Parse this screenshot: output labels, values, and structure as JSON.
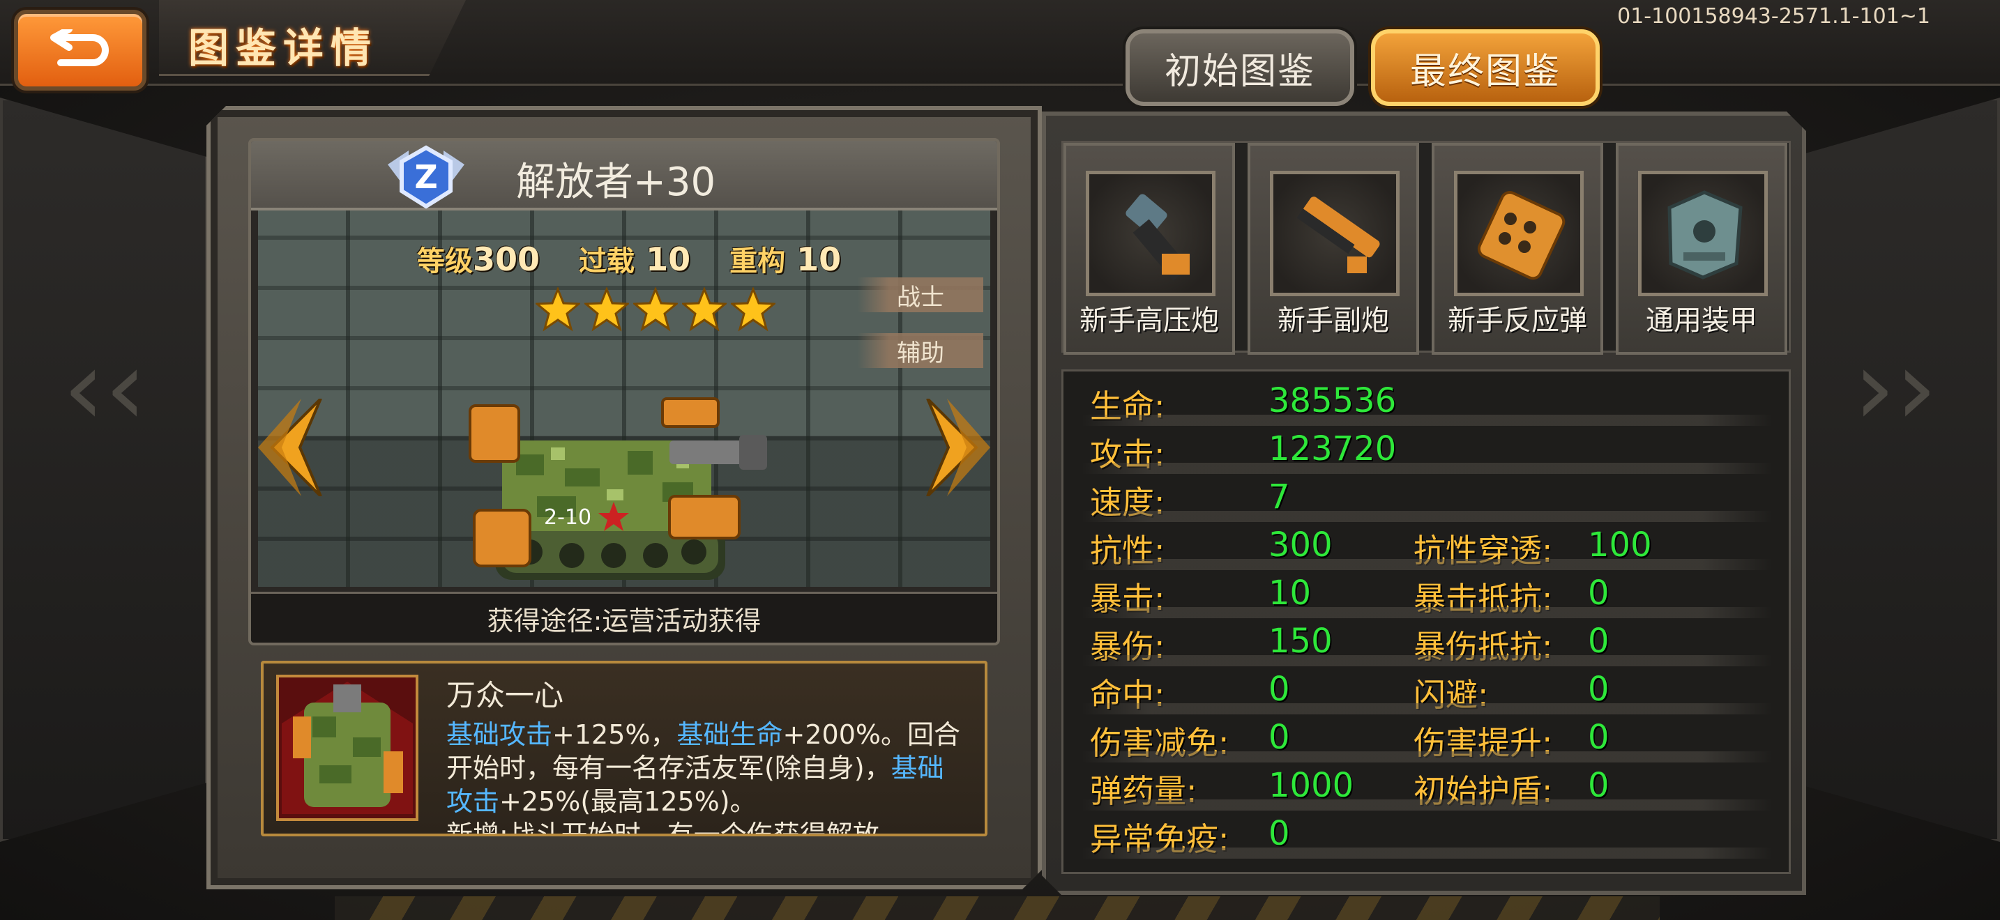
{
  "header": {
    "title": "图鉴详情",
    "version_code": "01-100158943-2571.1-101~1",
    "tabs": [
      {
        "label": "初始图鉴",
        "active": false
      },
      {
        "label": "最终图鉴",
        "active": true
      }
    ]
  },
  "unit": {
    "name": "解放者+30",
    "rank_badge": "Z",
    "stats_line": {
      "level_label": "等级",
      "level": "300",
      "overload_label": "过载",
      "overload": "10",
      "rebuild_label": "重构",
      "rebuild": "10"
    },
    "stars": 5,
    "roles": [
      "战士",
      "辅助"
    ],
    "source": "获得途径:运营活动获得",
    "hull_number": "2-10"
  },
  "skill": {
    "name": "万众一心",
    "desc": {
      "p1": "基础攻击",
      "p2": "+125%，",
      "p3": "基础生命",
      "p4": "+200%。回合开始时，每有一名存活友军(除自身)，",
      "p5": "基础攻击",
      "p6": "+25%(最高125%)。",
      "p7": "新增:战斗开始时，有一个伤获得解放"
    }
  },
  "equipment": [
    {
      "label": "新手高压炮",
      "icon": "cannon-icon"
    },
    {
      "label": "新手副炮",
      "icon": "secondary-gun-icon"
    },
    {
      "label": "新手反应弹",
      "icon": "reactive-shell-icon"
    },
    {
      "label": "通用装甲",
      "icon": "armor-icon"
    }
  ],
  "stats": {
    "hp": {
      "label": "生命:",
      "value": "385536"
    },
    "attack": {
      "label": "攻击:",
      "value": "123720"
    },
    "speed": {
      "label": "速度:",
      "value": "7"
    },
    "resist": {
      "label": "抗性:",
      "value": "300"
    },
    "resist_pen": {
      "label": "抗性穿透:",
      "value": "100"
    },
    "crit": {
      "label": "暴击:",
      "value": "10"
    },
    "crit_resist": {
      "label": "暴击抵抗:",
      "value": "0"
    },
    "crit_dmg": {
      "label": "暴伤:",
      "value": "150"
    },
    "crit_dmg_resist": {
      "label": "暴伤抵抗:",
      "value": "0"
    },
    "hit": {
      "label": "命中:",
      "value": "0"
    },
    "dodge": {
      "label": "闪避:",
      "value": "0"
    },
    "dmg_reduce": {
      "label": "伤害减免:",
      "value": "0"
    },
    "dmg_boost": {
      "label": "伤害提升:",
      "value": "0"
    },
    "ammo": {
      "label": "弹药量:",
      "value": "1000"
    },
    "shield": {
      "label": "初始护盾:",
      "value": "0"
    },
    "immunity": {
      "label": "异常免疫:",
      "value": "0"
    }
  },
  "colors": {
    "stat_label": "#ffbf3a",
    "stat_value": "#2ee83a",
    "skill_highlight": "#55b7ff",
    "accent_orange": "#f2a23a"
  }
}
